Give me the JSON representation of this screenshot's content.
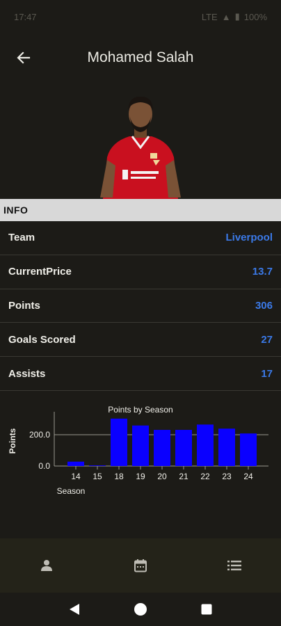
{
  "status_bar": {
    "time": "17:47",
    "battery": "100%",
    "network": "LTE"
  },
  "header": {
    "title": "Mohamed Salah"
  },
  "section": {
    "info_label": "INFO"
  },
  "info_rows": [
    {
      "label": "Team",
      "value": "Liverpool"
    },
    {
      "label": "CurrentPrice",
      "value": "13.7"
    },
    {
      "label": "Points",
      "value": "306"
    },
    {
      "label": "Goals Scored",
      "value": "27"
    },
    {
      "label": "Assists",
      "value": "17"
    }
  ],
  "colors": {
    "accent": "#3b7ae8",
    "bar": "#0a00ff",
    "background": "#1c1b17",
    "nav": "#242319"
  },
  "icons": {
    "back": "arrow-left-icon",
    "profile": "person-icon",
    "calendar": "calendar-icon",
    "list": "list-icon"
  },
  "chart_data": {
    "type": "bar",
    "title": "Points by Season",
    "xlabel": "Season",
    "ylabel": "Points",
    "categories": [
      "14",
      "15",
      "18",
      "19",
      "20",
      "21",
      "22",
      "23",
      "24"
    ],
    "values": [
      28,
      4,
      303,
      259,
      231,
      231,
      265,
      239,
      208
    ],
    "ylim": [
      0,
      320
    ],
    "yticks": [
      "0.0",
      "200.0"
    ],
    "grid": true
  }
}
